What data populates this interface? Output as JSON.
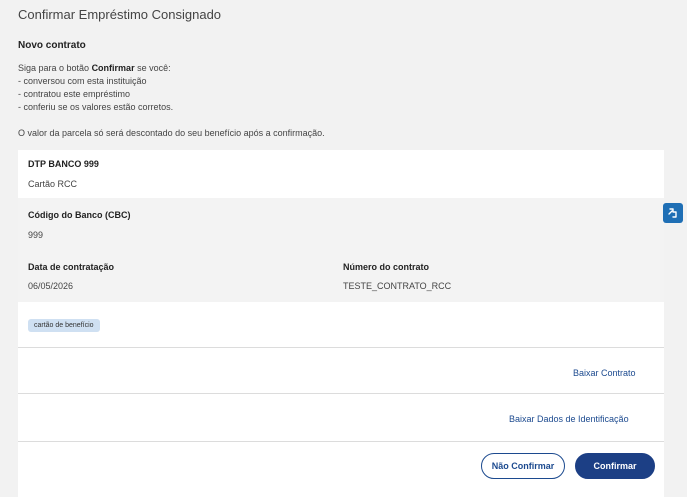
{
  "header": {
    "title": "Confirmar Empréstimo Consignado"
  },
  "intro": {
    "heading": "Novo contrato",
    "line1_prefix": "Siga para o botão ",
    "line1_bold": "Confirmar",
    "line1_suffix": " se você:",
    "bullet1": "- conversou com esta instituição",
    "bullet2": "- contratou este empréstimo",
    "bullet3": "- conferiu se os valores estão corretos.",
    "notice": "O valor da parcela só será descontado do seu benefício após a confirmação."
  },
  "contract": {
    "bank_name": "DTP BANCO 999",
    "product": "Cartão RCC",
    "bank_code_label": "Código do Banco (CBC)",
    "bank_code": "999",
    "date_label": "Data de contratação",
    "date": "06/05/2026",
    "number_label": "Número do contrato",
    "number": "TESTE_CONTRATO_RCC",
    "tag": "cartão de benefício"
  },
  "links": {
    "download_contract": "Baixar Contrato",
    "download_id_data": "Baixar Dados de Identificação"
  },
  "actions": {
    "reject": "Não Confirmar",
    "confirm": "Confirmar"
  },
  "colors": {
    "primary": "#1c3f85",
    "link": "#1c4a8f",
    "tag_bg": "#cfe0f2"
  },
  "icons": {
    "side_widget": "accessibility-icon"
  }
}
